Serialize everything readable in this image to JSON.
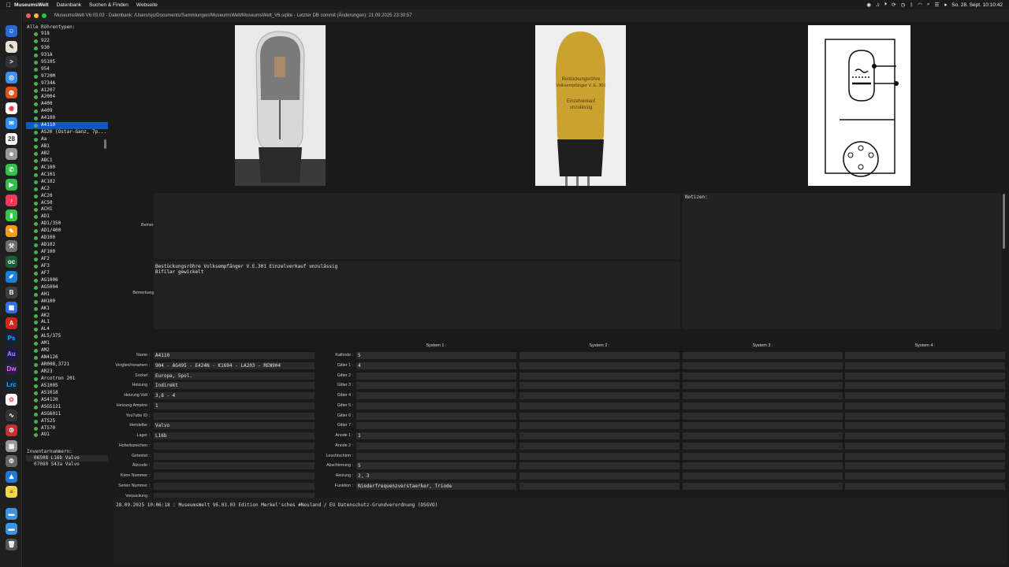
{
  "menubar": {
    "apple": "",
    "app": "MuseumsWelt",
    "menus": [
      "Datenbank",
      "Suchen & Finden",
      "Webseite"
    ],
    "clock": "So. 28. Sept. 10:10:42"
  },
  "window": {
    "title": "MuseumsWelt V6.03.03 - Datenbank: /Users/sjs/Documents/Sammlungen/MuseumsWelt/MuseumsWelt_V6.sqlite - Letzter DB commit (Änderungen): 21.09.2025 23:30:57"
  },
  "sidebar": {
    "header": "Alle Röhrentypen:",
    "tubes": [
      "918",
      "922",
      "930",
      "931A",
      "95105",
      "954",
      "9720M",
      "9734A",
      "A1207",
      "A2004",
      "A400",
      "A409",
      "A4100",
      "A4110",
      "AS20 (Ostar-Ganz, 7p...",
      "Aa",
      "AB1",
      "AB2",
      "ABC1",
      "AC100",
      "AC101",
      "AC102",
      "AC2",
      "AC20",
      "AC50",
      "ACH1",
      "AD1",
      "AD1/350",
      "AD1/400",
      "AD100",
      "AD102",
      "AF100",
      "AF2",
      "AF3",
      "AF7",
      "AG1006",
      "AG5004",
      "AH1",
      "AH100",
      "AK1",
      "AK2",
      "AL1",
      "AL4",
      "AL5/375",
      "AM1",
      "AM2",
      "AN4126",
      "AR008,3721",
      "AR23",
      "Arcotron 201",
      "AS1005",
      "AS1018",
      "AS4120",
      "ASG5121",
      "ASG6011",
      "ATS25",
      "ATS70",
      "AU1"
    ],
    "selected_index": 13,
    "inventory_header": "Inventarnummern:",
    "inventory": [
      "06508 L16b Valvo",
      "07080 S43a Valvo"
    ]
  },
  "notes": {
    "label": "Notizen:",
    "bemerkung_typ_label": "Bemerkung Typ :",
    "bemerkung_typ": "",
    "bemerkung_inventar_label": "Bemerkung Inventar :",
    "bemerkung_inventar_line1": "Bestückungsröhre Volksempfänger V.E.301 Einzelverkauf unzulässig",
    "bemerkung_inventar_line2": "Bifilar gewickelt"
  },
  "photo2_text": [
    "Bestückungsröhre",
    "Volksempfänger V. E. 301",
    "Einzelverkauf",
    "unzulässig"
  ],
  "fields": [
    {
      "label": "Name :",
      "value": "A4110"
    },
    {
      "label": "Vergleichsnamen :",
      "value": "904 - AG495 - E424N - K1694 - LA203 - REN904"
    },
    {
      "label": "Sockel :",
      "value": "Europa, 5pol."
    },
    {
      "label": "Heizung :",
      "value": "Indirekt"
    },
    {
      "label": "Heizung Volt :",
      "value": "3,8 - 4"
    },
    {
      "label": "Heizung Ampère :",
      "value": "1"
    },
    {
      "label": "YouTube ID :",
      "value": ""
    },
    {
      "label": "Hersteller :",
      "value": "Valvo"
    },
    {
      "label": "Lager :",
      "value": "L16b"
    },
    {
      "label": "Hoheitszeichen :",
      "value": ""
    },
    {
      "label": "Getestet :",
      "value": ""
    },
    {
      "label": "Ätzcode :",
      "value": ""
    },
    {
      "label": "Kenn Nummer :",
      "value": ""
    },
    {
      "label": "Serien Nummer :",
      "value": ""
    },
    {
      "label": "Verpackung :",
      "value": ""
    }
  ],
  "systems": {
    "headers": [
      "System 1 :",
      "System 2 :",
      "System 3 :",
      "System 4 :"
    ],
    "rows": [
      {
        "label": "Kathode :",
        "values": [
          "5",
          "",
          "",
          ""
        ]
      },
      {
        "label": "Gitter 1 :",
        "values": [
          "4",
          "",
          "",
          ""
        ]
      },
      {
        "label": "Gitter 2 :",
        "values": [
          "",
          "",
          "",
          ""
        ]
      },
      {
        "label": "Gitter 3 :",
        "values": [
          "",
          "",
          "",
          ""
        ]
      },
      {
        "label": "Gitter 4 :",
        "values": [
          "",
          "",
          "",
          ""
        ]
      },
      {
        "label": "Gitter 5 :",
        "values": [
          "",
          "",
          "",
          ""
        ]
      },
      {
        "label": "Gitter 6 :",
        "values": [
          "",
          "",
          "",
          ""
        ]
      },
      {
        "label": "Gitter 7 :",
        "values": [
          "",
          "",
          "",
          ""
        ]
      },
      {
        "label": "Anode 1 :",
        "values": [
          "1",
          "",
          "",
          ""
        ]
      },
      {
        "label": "Anode 2 :",
        "values": [
          "",
          "",
          "",
          ""
        ]
      },
      {
        "label": "Leuchtschirm :",
        "values": [
          "",
          "",
          "",
          ""
        ]
      },
      {
        "label": "Abschirmung :",
        "values": [
          "5",
          "",
          "",
          ""
        ]
      },
      {
        "label": "Heizung :",
        "values": [
          "2, 3",
          "",
          "",
          ""
        ]
      },
      {
        "label": "Funktion :",
        "values": [
          "Niederfrequenzverstaerker, Triode",
          "",
          "",
          ""
        ]
      }
    ]
  },
  "status": "28.09.2025 10:06:18 : MuseumsWelt V6.03.03 Edition Merkel'sches #Neuland / EU Datenschutz-Grundverordnung (DSGVO)",
  "colors": {
    "selection": "#0b55cf",
    "ok_dot": "#4cae4c"
  }
}
